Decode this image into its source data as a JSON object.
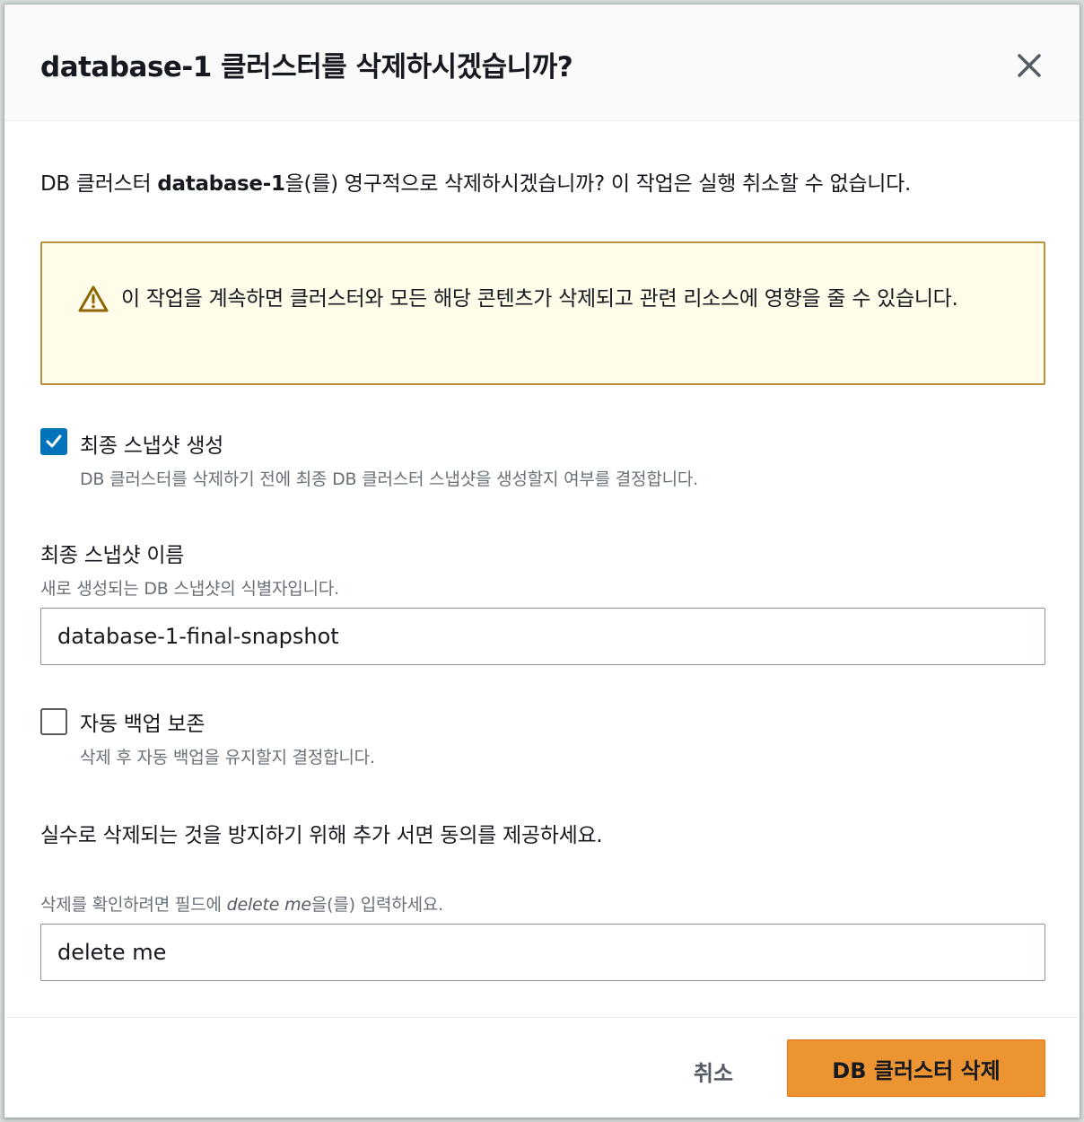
{
  "modal": {
    "title": "database-1 클러스터를 삭제하시겠습니까?",
    "close_icon": "close-icon"
  },
  "intro": {
    "prefix": "DB 클러스터 ",
    "name": "database-1",
    "suffix": "을(를) 영구적으로 삭제하시겠습니까? 이 작업은 실행 취소할 수 없습니다."
  },
  "alert": {
    "icon": "warning-icon",
    "text": "이 작업을 계속하면 클러스터와 모든 해당 콘텐츠가 삭제되고 관련 리소스에 영향을 줄 수 있습니다."
  },
  "final_snapshot": {
    "checked": true,
    "label": "최종 스냅샷 생성",
    "description": "DB 클러스터를 삭제하기 전에 최종 DB 클러스터 스냅샷을 생성할지 여부를 결정합니다."
  },
  "snapshot_name": {
    "label": "최종 스냅샷 이름",
    "description": "새로 생성되는 DB 스냅샷의 식별자입니다.",
    "value": "database-1-final-snapshot"
  },
  "retain_backups": {
    "checked": false,
    "label": "자동 백업 보존",
    "description": "삭제 후 자동 백업을 유지할지 결정합니다."
  },
  "confirm": {
    "heading": "실수로 삭제되는 것을 방지하기 위해 추가 서면 동의를 제공하세요.",
    "hint_prefix": "삭제를 확인하려면 필드에 ",
    "hint_keyword": "delete me",
    "hint_suffix": "을(를) 입력하세요.",
    "value": "delete me"
  },
  "footer": {
    "cancel_label": "취소",
    "delete_label": "DB 클러스터 삭제"
  },
  "colors": {
    "primary_button": "#ec9332",
    "checkbox_checked": "#0073bb",
    "alert_border": "#b8913a",
    "alert_background": "#fffce9"
  }
}
